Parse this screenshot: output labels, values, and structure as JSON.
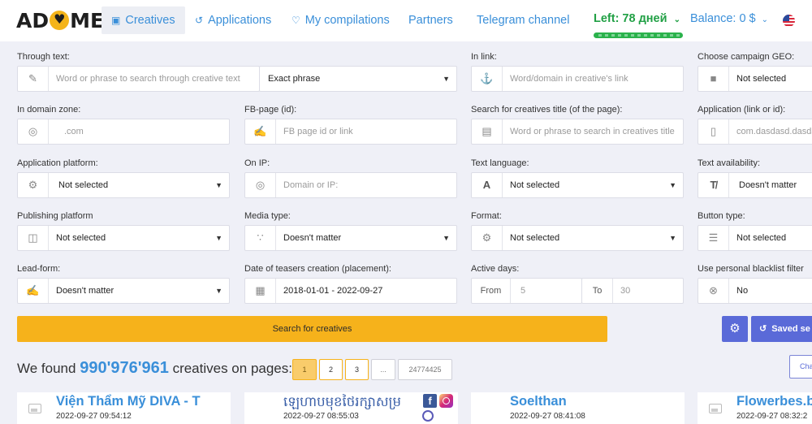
{
  "header": {
    "logo": {
      "left": "AD",
      "right": "ME"
    },
    "nav": [
      {
        "label": "Creatives",
        "icon": "image-icon",
        "active": true
      },
      {
        "label": "Applications",
        "icon": "app-icon",
        "active": false
      },
      {
        "label": "My compilations",
        "icon": "heart-icon",
        "active": false
      },
      {
        "label": "Partners",
        "active": false
      },
      {
        "label": "Telegram channel",
        "active": false
      }
    ],
    "subscription_left": "Left: 78 дней",
    "balance": "Balance: 0 $",
    "language_flag": "us-flag-icon"
  },
  "filters": {
    "through_text": {
      "label": "Through text:",
      "placeholder": "Word or phrase to search through creative text",
      "mode": "Exact phrase"
    },
    "in_link": {
      "label": "In link:",
      "placeholder": "Word/domain in creative's link"
    },
    "campaign_geo": {
      "label": "Choose campaign GEO:",
      "value": "Not selected"
    },
    "domain_zone": {
      "label": "In domain zone:",
      "placeholder": ".com"
    },
    "fb_page": {
      "label": "FB-page (id):",
      "placeholder": "FB page id or link"
    },
    "creative_title": {
      "label": "Search for creatives title (of the page):",
      "placeholder": "Word or phrase to search in creatives title"
    },
    "application": {
      "label": "Application (link or id):",
      "placeholder": "com.dasdasd.dasdasd"
    },
    "app_platform": {
      "label": "Application platform:",
      "value": "Not selected"
    },
    "on_ip": {
      "label": "On IP:",
      "placeholder": "Domain or IP:"
    },
    "text_language": {
      "label": "Text language:",
      "value": "Not selected"
    },
    "text_availability": {
      "label": "Text availability:",
      "value": "Doesn't matter"
    },
    "publishing_platform": {
      "label": "Publishing platform",
      "value": "Not selected"
    },
    "media_type": {
      "label": "Media type:",
      "value": "Doesn't matter"
    },
    "format": {
      "label": "Format:",
      "value": "Not selected"
    },
    "button_type": {
      "label": "Button type:",
      "value": "Not selected"
    },
    "lead_form": {
      "label": "Lead-form:",
      "value": "Doesn't matter"
    },
    "date_creation": {
      "label": "Date of teasers creation (placement):",
      "value": "2018-01-01 - 2022-09-27"
    },
    "active_days": {
      "label": "Active days:",
      "from_label": "From",
      "from_placeholder": "5",
      "to_label": "To",
      "to_placeholder": "30"
    },
    "blacklist": {
      "label": "Use personal blacklist filter",
      "value": "No"
    }
  },
  "actions": {
    "search_label": "Search for creatives",
    "saved_label": "Saved se"
  },
  "results": {
    "prefix": "We found",
    "count": "990'976'961",
    "suffix": "creatives on pages:",
    "pages": [
      "1",
      "2",
      "3",
      "...",
      "24774425"
    ],
    "change_label": "Cha"
  },
  "cards": [
    {
      "title": "Viện Thẩm Mỹ DIVA - T",
      "date": "2022-09-27 09:54:12"
    },
    {
      "title": "ឡេហាបមុខថៃរក្សាសម្រ",
      "date": "2022-09-27 08:55:03"
    },
    {
      "title": "Soelthan",
      "date": "2022-09-27 08:41:08"
    },
    {
      "title": "Flowerbes.b",
      "date": "2022-09-27 08:32:2"
    }
  ],
  "colors": {
    "accent_blue": "#3a8fd9",
    "search_yellow": "#f6b21b",
    "button_indigo": "#5a6ad8",
    "green": "#21a045"
  }
}
